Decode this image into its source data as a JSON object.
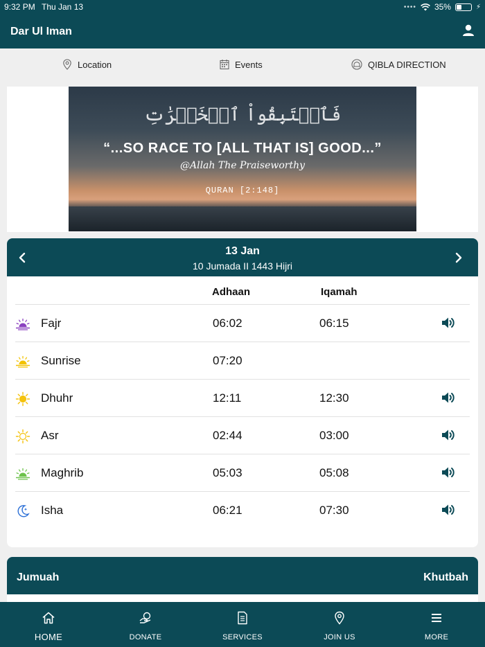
{
  "status_bar": {
    "time": "9:32 PM",
    "date": "Thu Jan 13",
    "battery": "35%",
    "battery_level": 0.35
  },
  "app": {
    "title": "Dar Ul Iman",
    "user_icon": "user-icon"
  },
  "quick_links": [
    {
      "label": "Location",
      "icon": "map-pin-icon"
    },
    {
      "label": "Events",
      "icon": "calendar-icon"
    },
    {
      "label": "QIBLA DIRECTION",
      "icon": "mosque-icon"
    }
  ],
  "banner": {
    "arabic": "فَٱسۡتَبِقُواْ ٱلۡخَيۡرَٰتِ",
    "quote": "“...SO RACE TO [ALL THAT IS] GOOD...”",
    "author": "@Allah The Praiseworthy",
    "reference": "QURAN [2:148]"
  },
  "prayer_times": {
    "date": "13 Jan",
    "hijri": "10 Jumada II 1443 Hijri",
    "columns": {
      "adhaan": "Adhaan",
      "iqamah": "Iqamah"
    },
    "rows": [
      {
        "name": "Fajr",
        "adhaan": "06:02",
        "iqamah": "06:15",
        "icon_color": "#8a3fbf"
      },
      {
        "name": "Sunrise",
        "adhaan": "07:20",
        "iqamah": "",
        "icon_color": "#f2c200"
      },
      {
        "name": "Dhuhr",
        "adhaan": "12:11",
        "iqamah": "12:30",
        "icon_color": "#f4c20d"
      },
      {
        "name": "Asr",
        "adhaan": "02:44",
        "iqamah": "03:00",
        "icon_color": "#f4c20d"
      },
      {
        "name": "Maghrib",
        "adhaan": "05:03",
        "iqamah": "05:08",
        "icon_color": "#6cc24a"
      },
      {
        "name": "Isha",
        "adhaan": "06:21",
        "iqamah": "07:30",
        "icon_color": "#2b6fd6"
      }
    ]
  },
  "jumuah": {
    "left": "Jumuah",
    "right": "Khutbah"
  },
  "bottom_nav": [
    {
      "label": "HOME",
      "icon": "home-icon"
    },
    {
      "label": "DONATE",
      "icon": "donate-icon"
    },
    {
      "label": "SERVICES",
      "icon": "document-icon"
    },
    {
      "label": "JOIN US",
      "icon": "map-pin-icon"
    },
    {
      "label": "MORE",
      "icon": "menu-icon"
    }
  ],
  "colors": {
    "brand": "#0c4a56",
    "background": "#efefef"
  }
}
